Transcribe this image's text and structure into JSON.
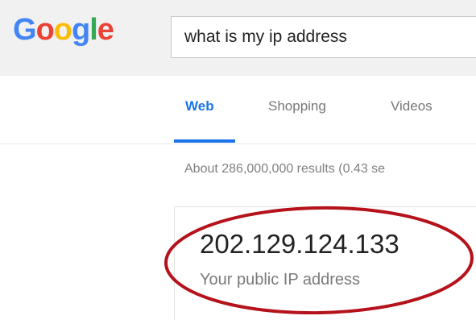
{
  "header": {
    "logo": [
      "G",
      "o",
      "o",
      "g",
      "l",
      "e"
    ]
  },
  "search": {
    "query": "what is my ip address"
  },
  "tabs": [
    {
      "label": "Web",
      "active": true
    },
    {
      "label": "Shopping",
      "active": false
    },
    {
      "label": "Videos",
      "active": false
    }
  ],
  "results": {
    "stats": "About 286,000,000 results (0.43 se"
  },
  "ip_card": {
    "ip": "202.129.124.133",
    "caption": "Your public IP address"
  },
  "colors": {
    "google_blue": "#4285f4",
    "google_red": "#ea4335",
    "google_yellow": "#fbbc05",
    "google_green": "#34a853",
    "tab_active": "#1a73e8",
    "annotation_circle": "#b5121b"
  }
}
